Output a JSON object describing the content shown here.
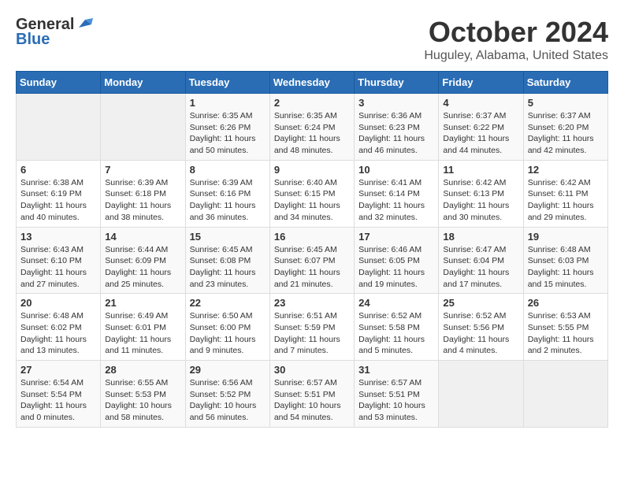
{
  "header": {
    "logo_general": "General",
    "logo_blue": "Blue",
    "title": "October 2024",
    "location": "Huguley, Alabama, United States"
  },
  "days_of_week": [
    "Sunday",
    "Monday",
    "Tuesday",
    "Wednesday",
    "Thursday",
    "Friday",
    "Saturday"
  ],
  "weeks": [
    [
      {
        "day": "",
        "info": ""
      },
      {
        "day": "",
        "info": ""
      },
      {
        "day": "1",
        "info": "Sunrise: 6:35 AM\nSunset: 6:26 PM\nDaylight: 11 hours and 50 minutes."
      },
      {
        "day": "2",
        "info": "Sunrise: 6:35 AM\nSunset: 6:24 PM\nDaylight: 11 hours and 48 minutes."
      },
      {
        "day": "3",
        "info": "Sunrise: 6:36 AM\nSunset: 6:23 PM\nDaylight: 11 hours and 46 minutes."
      },
      {
        "day": "4",
        "info": "Sunrise: 6:37 AM\nSunset: 6:22 PM\nDaylight: 11 hours and 44 minutes."
      },
      {
        "day": "5",
        "info": "Sunrise: 6:37 AM\nSunset: 6:20 PM\nDaylight: 11 hours and 42 minutes."
      }
    ],
    [
      {
        "day": "6",
        "info": "Sunrise: 6:38 AM\nSunset: 6:19 PM\nDaylight: 11 hours and 40 minutes."
      },
      {
        "day": "7",
        "info": "Sunrise: 6:39 AM\nSunset: 6:18 PM\nDaylight: 11 hours and 38 minutes."
      },
      {
        "day": "8",
        "info": "Sunrise: 6:39 AM\nSunset: 6:16 PM\nDaylight: 11 hours and 36 minutes."
      },
      {
        "day": "9",
        "info": "Sunrise: 6:40 AM\nSunset: 6:15 PM\nDaylight: 11 hours and 34 minutes."
      },
      {
        "day": "10",
        "info": "Sunrise: 6:41 AM\nSunset: 6:14 PM\nDaylight: 11 hours and 32 minutes."
      },
      {
        "day": "11",
        "info": "Sunrise: 6:42 AM\nSunset: 6:13 PM\nDaylight: 11 hours and 30 minutes."
      },
      {
        "day": "12",
        "info": "Sunrise: 6:42 AM\nSunset: 6:11 PM\nDaylight: 11 hours and 29 minutes."
      }
    ],
    [
      {
        "day": "13",
        "info": "Sunrise: 6:43 AM\nSunset: 6:10 PM\nDaylight: 11 hours and 27 minutes."
      },
      {
        "day": "14",
        "info": "Sunrise: 6:44 AM\nSunset: 6:09 PM\nDaylight: 11 hours and 25 minutes."
      },
      {
        "day": "15",
        "info": "Sunrise: 6:45 AM\nSunset: 6:08 PM\nDaylight: 11 hours and 23 minutes."
      },
      {
        "day": "16",
        "info": "Sunrise: 6:45 AM\nSunset: 6:07 PM\nDaylight: 11 hours and 21 minutes."
      },
      {
        "day": "17",
        "info": "Sunrise: 6:46 AM\nSunset: 6:05 PM\nDaylight: 11 hours and 19 minutes."
      },
      {
        "day": "18",
        "info": "Sunrise: 6:47 AM\nSunset: 6:04 PM\nDaylight: 11 hours and 17 minutes."
      },
      {
        "day": "19",
        "info": "Sunrise: 6:48 AM\nSunset: 6:03 PM\nDaylight: 11 hours and 15 minutes."
      }
    ],
    [
      {
        "day": "20",
        "info": "Sunrise: 6:48 AM\nSunset: 6:02 PM\nDaylight: 11 hours and 13 minutes."
      },
      {
        "day": "21",
        "info": "Sunrise: 6:49 AM\nSunset: 6:01 PM\nDaylight: 11 hours and 11 minutes."
      },
      {
        "day": "22",
        "info": "Sunrise: 6:50 AM\nSunset: 6:00 PM\nDaylight: 11 hours and 9 minutes."
      },
      {
        "day": "23",
        "info": "Sunrise: 6:51 AM\nSunset: 5:59 PM\nDaylight: 11 hours and 7 minutes."
      },
      {
        "day": "24",
        "info": "Sunrise: 6:52 AM\nSunset: 5:58 PM\nDaylight: 11 hours and 5 minutes."
      },
      {
        "day": "25",
        "info": "Sunrise: 6:52 AM\nSunset: 5:56 PM\nDaylight: 11 hours and 4 minutes."
      },
      {
        "day": "26",
        "info": "Sunrise: 6:53 AM\nSunset: 5:55 PM\nDaylight: 11 hours and 2 minutes."
      }
    ],
    [
      {
        "day": "27",
        "info": "Sunrise: 6:54 AM\nSunset: 5:54 PM\nDaylight: 11 hours and 0 minutes."
      },
      {
        "day": "28",
        "info": "Sunrise: 6:55 AM\nSunset: 5:53 PM\nDaylight: 10 hours and 58 minutes."
      },
      {
        "day": "29",
        "info": "Sunrise: 6:56 AM\nSunset: 5:52 PM\nDaylight: 10 hours and 56 minutes."
      },
      {
        "day": "30",
        "info": "Sunrise: 6:57 AM\nSunset: 5:51 PM\nDaylight: 10 hours and 54 minutes."
      },
      {
        "day": "31",
        "info": "Sunrise: 6:57 AM\nSunset: 5:51 PM\nDaylight: 10 hours and 53 minutes."
      },
      {
        "day": "",
        "info": ""
      },
      {
        "day": "",
        "info": ""
      }
    ]
  ]
}
